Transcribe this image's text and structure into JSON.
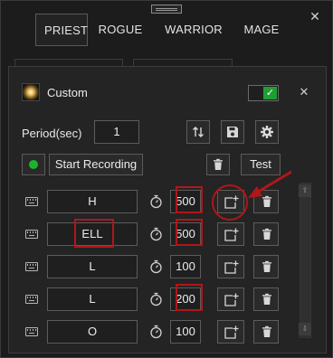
{
  "window": {
    "close_glyph": "✕"
  },
  "tabs": [
    {
      "label": "PRIEST",
      "active": true
    },
    {
      "label": "ROGUE",
      "active": false
    },
    {
      "label": "WARRIOR",
      "active": false
    },
    {
      "label": "MAGE",
      "active": false
    }
  ],
  "panel": {
    "title": "Custom",
    "icon": "spark-icon",
    "toggle": {
      "checked": true,
      "glyph": "✓",
      "color": "#1f9e33"
    },
    "close_glyph": "✕",
    "period": {
      "label": "Period(sec)",
      "value": "1"
    },
    "toolbar_icons": [
      "sort-updown-icon",
      "save-icon",
      "gear-icon"
    ],
    "record_button_label": "Start Recording",
    "record_status_color": "#1db32f",
    "test_button_label": "Test"
  },
  "rows": [
    {
      "key": "H",
      "delay": "500",
      "key_highlighted": false,
      "delay_highlighted": true,
      "add_highlighted": true
    },
    {
      "key": "ELL",
      "delay": "500",
      "key_highlighted": true,
      "delay_highlighted": true,
      "add_highlighted": false
    },
    {
      "key": "L",
      "delay": "100",
      "key_highlighted": false,
      "delay_highlighted": false,
      "add_highlighted": false
    },
    {
      "key": "L",
      "delay": "200",
      "key_highlighted": false,
      "delay_highlighted": true,
      "add_highlighted": false
    },
    {
      "key": "O",
      "delay": "100",
      "key_highlighted": false,
      "delay_highlighted": false,
      "add_highlighted": false
    }
  ],
  "scrollbar": {
    "up_glyph": "⇧",
    "down_glyph": "⇩"
  },
  "annotation_color": "#b0161a"
}
